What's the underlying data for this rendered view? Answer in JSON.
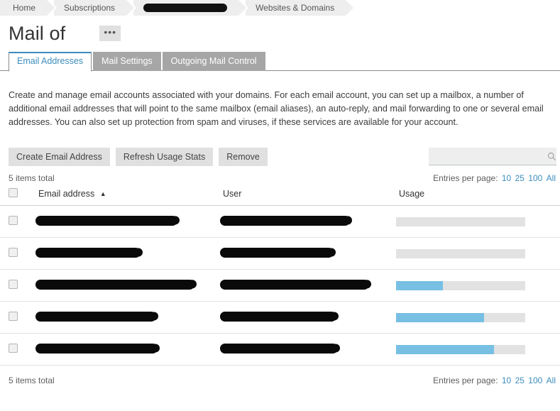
{
  "breadcrumb": {
    "items": [
      {
        "label": "Home",
        "redacted": false
      },
      {
        "label": "Subscriptions",
        "redacted": false
      },
      {
        "label": "",
        "redacted": true
      },
      {
        "label": "Websites & Domains",
        "redacted": false
      }
    ]
  },
  "header": {
    "title": "Mail of",
    "more_button_label": "•••"
  },
  "tabs": [
    {
      "label": "Email Addresses",
      "active": true
    },
    {
      "label": "Mail Settings",
      "active": false
    },
    {
      "label": "Outgoing Mail Control",
      "active": false
    }
  ],
  "description": "Create and manage email accounts associated with your domains. For each email account, you can set up a mailbox, a number of additional email addresses that will point to the same mailbox (email aliases), an auto-reply, and mail forwarding to one or several email addresses. You can also set up protection from spam and viruses, if these services are available for your account.",
  "toolbar": {
    "create_label": "Create Email Address",
    "refresh_label": "Refresh Usage Stats",
    "remove_label": "Remove",
    "search_placeholder": "",
    "search_value": "",
    "search_icon": "search-icon"
  },
  "pagination": {
    "items_total": "5 items total",
    "entries_label": "Entries per page:",
    "options": [
      "10",
      "25",
      "100",
      "All"
    ]
  },
  "table": {
    "columns": [
      {
        "label": "Email address",
        "sorted": "asc"
      },
      {
        "label": "User",
        "sorted": ""
      },
      {
        "label": "Usage",
        "sorted": ""
      }
    ],
    "rows": [
      {
        "email_redacted_width": 200,
        "user_redacted_width": 183,
        "usage_percent": 0,
        "info_icon": "info-icon",
        "mail_icon": "envelope-icon"
      },
      {
        "email_redacted_width": 148,
        "user_redacted_width": 160,
        "usage_percent": 0,
        "info_icon": "info-icon",
        "mail_icon": "envelope-icon"
      },
      {
        "email_redacted_width": 224,
        "user_redacted_width": 210,
        "usage_percent": 36,
        "info_icon": "info-icon",
        "mail_icon": "envelope-icon"
      },
      {
        "email_redacted_width": 170,
        "user_redacted_width": 164,
        "usage_percent": 68,
        "info_icon": "info-icon",
        "mail_icon": "envelope-icon"
      },
      {
        "email_redacted_width": 172,
        "user_redacted_width": 166,
        "usage_percent": 76,
        "info_icon": "info-icon",
        "mail_icon": "envelope-icon"
      }
    ]
  },
  "colors": {
    "accent": "#3c8dbc",
    "usage_fill": "#77c0e3",
    "tab_inactive": "#a6a6a6",
    "button_bg": "#e0e0e0"
  }
}
